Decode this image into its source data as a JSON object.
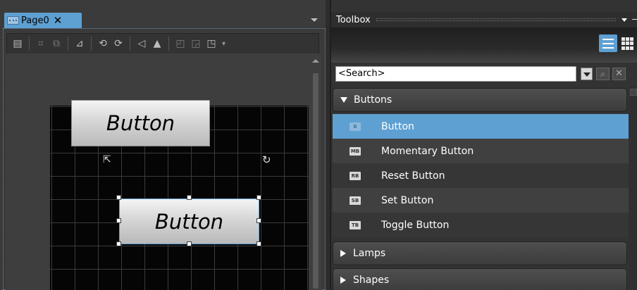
{
  "document": {
    "tab_label": "Page0",
    "close_glyph": "✕",
    "toolbar_icons": [
      "properties-icon",
      "group-icon",
      "ungroup-icon",
      "align-icon",
      "rotate-left-icon",
      "rotate-right-icon",
      "flip-horizontal-icon",
      "flip-vertical-icon",
      "bring-forward-icon",
      "send-backward-icon",
      "order-icon"
    ],
    "canvas": {
      "button1_text": "Button",
      "button2_text": "Button"
    }
  },
  "toolbox": {
    "title": "Toolbox",
    "search_text": "<Search>",
    "groups": [
      {
        "label": "Buttons",
        "expanded": true,
        "items": [
          {
            "badge": "B",
            "label": "Button",
            "selected": true
          },
          {
            "badge": "MB",
            "label": "Momentary Button",
            "selected": false
          },
          {
            "badge": "RB",
            "label": "Reset Button",
            "selected": false
          },
          {
            "badge": "SB",
            "label": "Set Button",
            "selected": false
          },
          {
            "badge": "TB",
            "label": "Toggle Button",
            "selected": false
          }
        ]
      },
      {
        "label": "Lamps",
        "expanded": false
      },
      {
        "label": "Shapes",
        "expanded": false
      }
    ]
  },
  "colors": {
    "accent": "#5ea0d2",
    "panel_bg": "#333333",
    "canvas_bg": "#050505"
  }
}
